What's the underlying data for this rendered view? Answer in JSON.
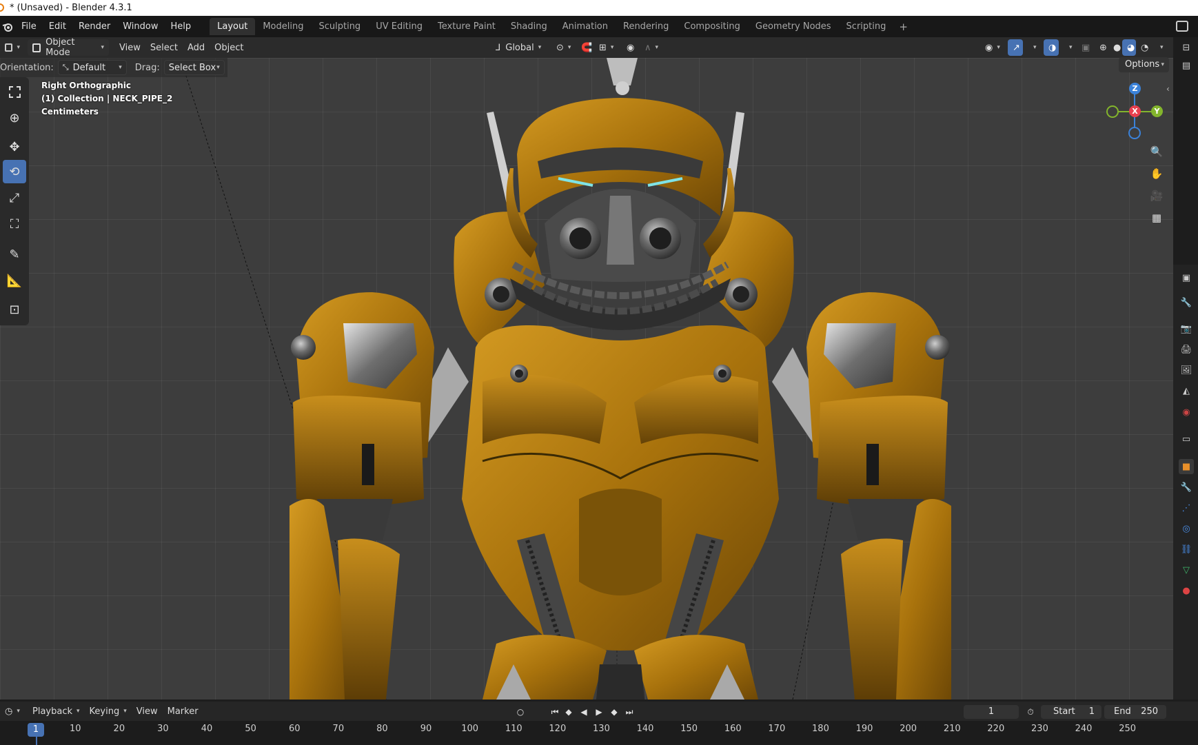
{
  "window": {
    "title": "* (Unsaved) - Blender 4.3.1"
  },
  "menubar": {
    "items": [
      "File",
      "Edit",
      "Render",
      "Window",
      "Help"
    ]
  },
  "workspaces": {
    "active": "Layout",
    "tabs": [
      "Layout",
      "Modeling",
      "Sculpting",
      "UV Editing",
      "Texture Paint",
      "Shading",
      "Animation",
      "Rendering",
      "Compositing",
      "Geometry Nodes",
      "Scripting"
    ],
    "add": "+"
  },
  "viewport_header": {
    "mode": "Object Mode",
    "menus": [
      "View",
      "Select",
      "Add",
      "Object"
    ],
    "transform_orientation": "Global"
  },
  "tool_settings": {
    "orientation_label": "Orientation:",
    "orientation_value": "Default",
    "drag_label": "Drag:",
    "drag_value": "Select Box",
    "options": "Options"
  },
  "viewport_overlay": {
    "view_name": "Right Orthographic",
    "collection": "(1) Collection | NECK_PIPE_2",
    "units": "Centimeters"
  },
  "gizmo": {
    "z": "Z",
    "x": "X",
    "y": "Y"
  },
  "colors": {
    "accent": "#4772b3",
    "robot_paint": "#b07a10",
    "gizmo_x": "#e8404f",
    "gizmo_y": "#83b52c",
    "gizmo_z": "#3b82d9"
  },
  "toolbar_icons": [
    "select-box-icon",
    "cursor-icon",
    "move-icon",
    "rotate-icon",
    "scale-icon",
    "transform-icon",
    "annotate-icon",
    "measure-icon",
    "add-cube-icon"
  ],
  "timeline": {
    "menus": [
      "Playback",
      "Keying",
      "View",
      "Marker"
    ],
    "current_frame": "1",
    "start_label": "Start",
    "start_value": "1",
    "end_label": "End",
    "end_value": "250",
    "ruler_current": "1",
    "ruler_ticks": [
      "10",
      "20",
      "30",
      "40",
      "50",
      "60",
      "70",
      "80",
      "90",
      "100",
      "110",
      "120",
      "130",
      "140",
      "150",
      "160",
      "170",
      "180",
      "190",
      "200",
      "210",
      "220",
      "230",
      "240",
      "250"
    ]
  }
}
